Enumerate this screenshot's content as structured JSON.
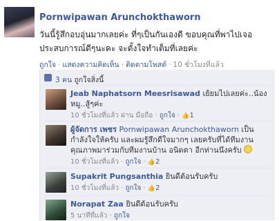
{
  "post": {
    "author": "Pornwipawan Arunchokthaworn",
    "status_text": "วันนี้รู้สึกอบอุ่นมากเลยค่ะ ที่ๆเป็นกันเองดี ขอบคุณที่พาไปเจอประสบการณ์ดีๆนะคะ จะตั้งใจทำเต็มที่เลยค่ะ",
    "actions": {
      "like": "ถูกใจ",
      "comment": "แสดงความคิดเห็น",
      "follow": "ติดตามโพสต์",
      "time": "10 ชั่วโมงที่แล้ว"
    },
    "likes_summary": {
      "count": "3 คน",
      "suffix": "ถูกใจสิ่งนี้"
    }
  },
  "comments": [
    {
      "author": "Jeab Naphatsorn Meesrisawad",
      "text": "เย้ยมไปเลยค่ะ..น้อง หมู..สู้ๆค่ะ",
      "time": "10 ชั่วโมงที่แล้ว",
      "via": "ผ่าน มือถือ",
      "like_label": "ถูกใจ",
      "like_count": "1"
    },
    {
      "author": "ผู้จัดการ เพชร",
      "mention": "Pornwipawan Arunchokthaworn",
      "text": "เป็นกำลังใจให้ครับ และผมรู้สึกดีใจมากๆ เลยครับที่ได้ทีมงานคุณภาพมาร่วมกับทีมงานบ้าน อนิดตา อีกท่านนึงครับ",
      "time": "10 ชั่วโมงที่แล้ว",
      "like_label": "ถูกใจ",
      "like_count": "2"
    },
    {
      "author": "Supakrit Pungsanthia",
      "text": "ยินดีต้อนรับครับ",
      "time": "10 ชั่วโมงที่แล้ว",
      "like_label": "ถูกใจ",
      "like_count": "2"
    },
    {
      "author": "Norapat Zaa",
      "text": "ยินดีต้อนรับครับ",
      "time": "5 นาทีที่แล้ว",
      "like_label": "ถูกใจ"
    }
  ]
}
